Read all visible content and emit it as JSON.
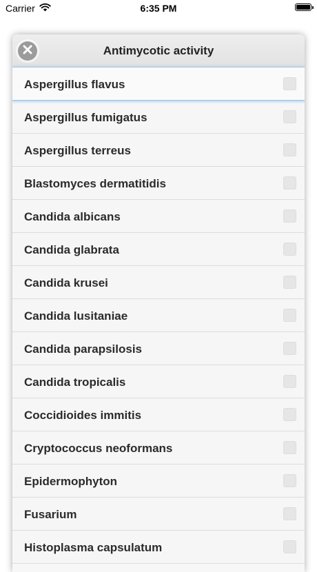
{
  "status_bar": {
    "carrier": "Carrier",
    "time": "6:35 PM",
    "wifi_icon": "wifi-icon",
    "battery_icon": "battery-icon"
  },
  "dialog": {
    "title": "Antimycotic activity",
    "close_icon": "close-icon",
    "items": [
      {
        "label": "Aspergillus flavus",
        "checked": false,
        "selected": true
      },
      {
        "label": "Aspergillus fumigatus",
        "checked": false
      },
      {
        "label": "Aspergillus terreus",
        "checked": false
      },
      {
        "label": "Blastomyces dermatitidis",
        "checked": false
      },
      {
        "label": "Candida albicans",
        "checked": false
      },
      {
        "label": "Candida glabrata",
        "checked": false
      },
      {
        "label": "Candida krusei",
        "checked": false
      },
      {
        "label": "Candida lusitaniae",
        "checked": false
      },
      {
        "label": "Candida parapsilosis",
        "checked": false
      },
      {
        "label": "Candida tropicalis",
        "checked": false
      },
      {
        "label": "Coccidioides immitis",
        "checked": false
      },
      {
        "label": "Cryptococcus neoformans",
        "checked": false
      },
      {
        "label": "Epidermophyton",
        "checked": false
      },
      {
        "label": "Fusarium",
        "checked": false
      },
      {
        "label": "Histoplasma capsulatum",
        "checked": false
      }
    ]
  },
  "colors": {
    "selection_glow": "#9fc5e8",
    "close_button": "#9b9b9b"
  }
}
